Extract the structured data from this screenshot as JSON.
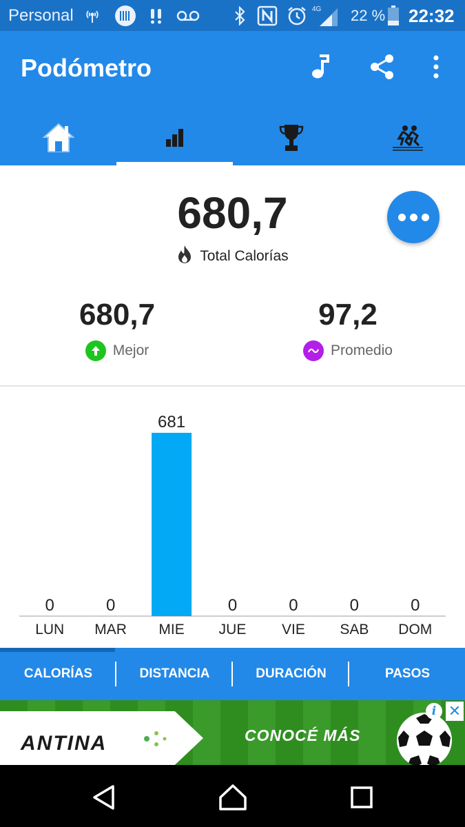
{
  "status_bar": {
    "carrier": "Personal",
    "network": "4G",
    "battery": "22 %",
    "time": "22:32",
    "icons": [
      "wifi-hotspot-icon",
      "barcode-icon",
      "notification-icon",
      "voicemail-icon",
      "bluetooth-icon",
      "nfc-icon",
      "alarm-icon",
      "signal-icon",
      "battery-icon"
    ]
  },
  "app_bar": {
    "title": "Podómetro",
    "actions": [
      "music-icon",
      "share-icon",
      "overflow-menu-icon"
    ],
    "tabs": [
      {
        "icon": "home-icon",
        "selected": false
      },
      {
        "icon": "bar-chart-icon",
        "selected": true
      },
      {
        "icon": "trophy-icon",
        "selected": false
      },
      {
        "icon": "runners-icon",
        "selected": false
      }
    ]
  },
  "summary": {
    "total_value": "680,7",
    "total_label": "Total Calorías",
    "best_value": "680,7",
    "best_label": "Mejor",
    "average_value": "97,2",
    "average_label": "Promedio"
  },
  "colors": {
    "primary": "#2289e8",
    "status_bar": "#1a72c7",
    "bar": "#03a9f4",
    "best_icon": "#1ec51e",
    "average_icon": "#b31ee8"
  },
  "chart_data": {
    "type": "bar",
    "categories": [
      "LUN",
      "MAR",
      "MIE",
      "JUE",
      "VIE",
      "SAB",
      "DOM"
    ],
    "values": [
      0,
      0,
      681,
      0,
      0,
      0,
      0
    ],
    "data_labels": [
      "0",
      "0",
      "681",
      "0",
      "0",
      "0",
      "0"
    ],
    "ylim": [
      0,
      681
    ],
    "grid": false,
    "title": "",
    "xlabel": "",
    "ylabel": ""
  },
  "metric_tabs": [
    {
      "label": "CALORÍAS",
      "selected": true
    },
    {
      "label": "DISTANCIA",
      "selected": false
    },
    {
      "label": "DURACIÓN",
      "selected": false
    },
    {
      "label": "PASOS",
      "selected": false
    }
  ],
  "ad": {
    "brand": "ANTINA",
    "cta": "CONOCÉ MÁS",
    "info": "i",
    "close": "✕"
  },
  "nav_bar": [
    "back-icon",
    "home-icon",
    "recents-icon"
  ]
}
